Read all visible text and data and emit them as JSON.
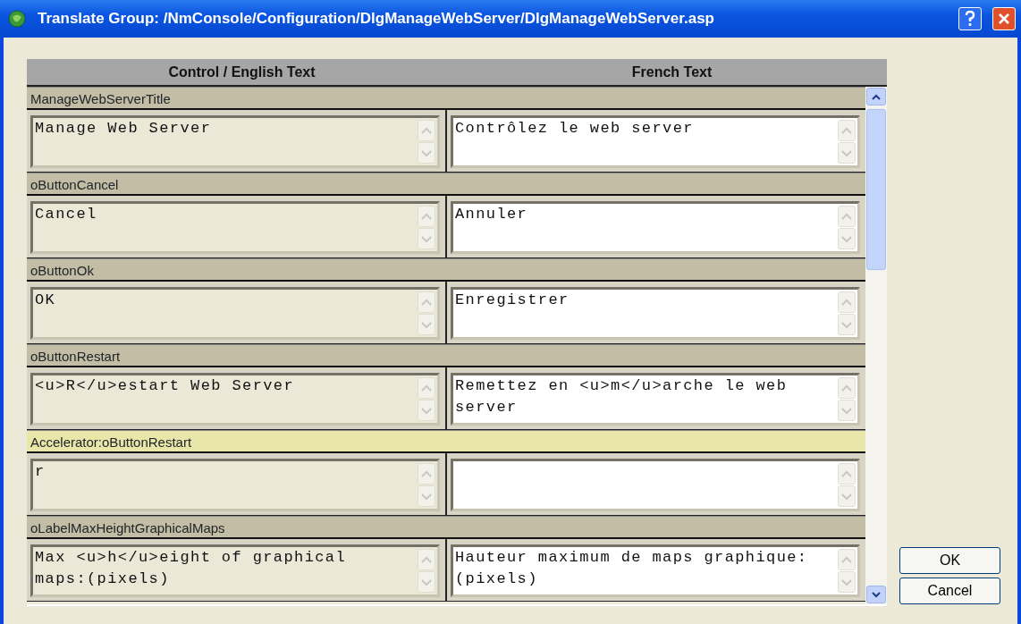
{
  "window": {
    "title": "Translate Group: /NmConsole/Configuration/DlgManageWebServer/DlgManageWebServer.asp"
  },
  "table": {
    "columns": [
      "Control / English Text",
      "French Text"
    ],
    "rows": [
      {
        "key": "ManageWebServerTitle",
        "highlighted": false,
        "english": "Manage Web Server",
        "french": "Contrôlez le web server"
      },
      {
        "key": "oButtonCancel",
        "highlighted": false,
        "english": "Cancel",
        "french": "Annuler"
      },
      {
        "key": "oButtonOk",
        "highlighted": false,
        "english": "OK",
        "french": "Enregistrer"
      },
      {
        "key": "oButtonRestart",
        "highlighted": false,
        "english": "<u>R</u>estart Web Server",
        "french": "Remettez en <u>m</u>arche le web server"
      },
      {
        "key": "Accelerator:oButtonRestart",
        "highlighted": true,
        "english": "r",
        "french": ""
      },
      {
        "key": "oLabelMaxHeightGraphicalMaps",
        "highlighted": false,
        "english": "Max <u>h</u>eight of graphical maps:(pixels)",
        "french": "Hauteur maximum de maps graphique:(pixels)"
      }
    ]
  },
  "buttons": [
    "OK",
    "Cancel"
  ]
}
